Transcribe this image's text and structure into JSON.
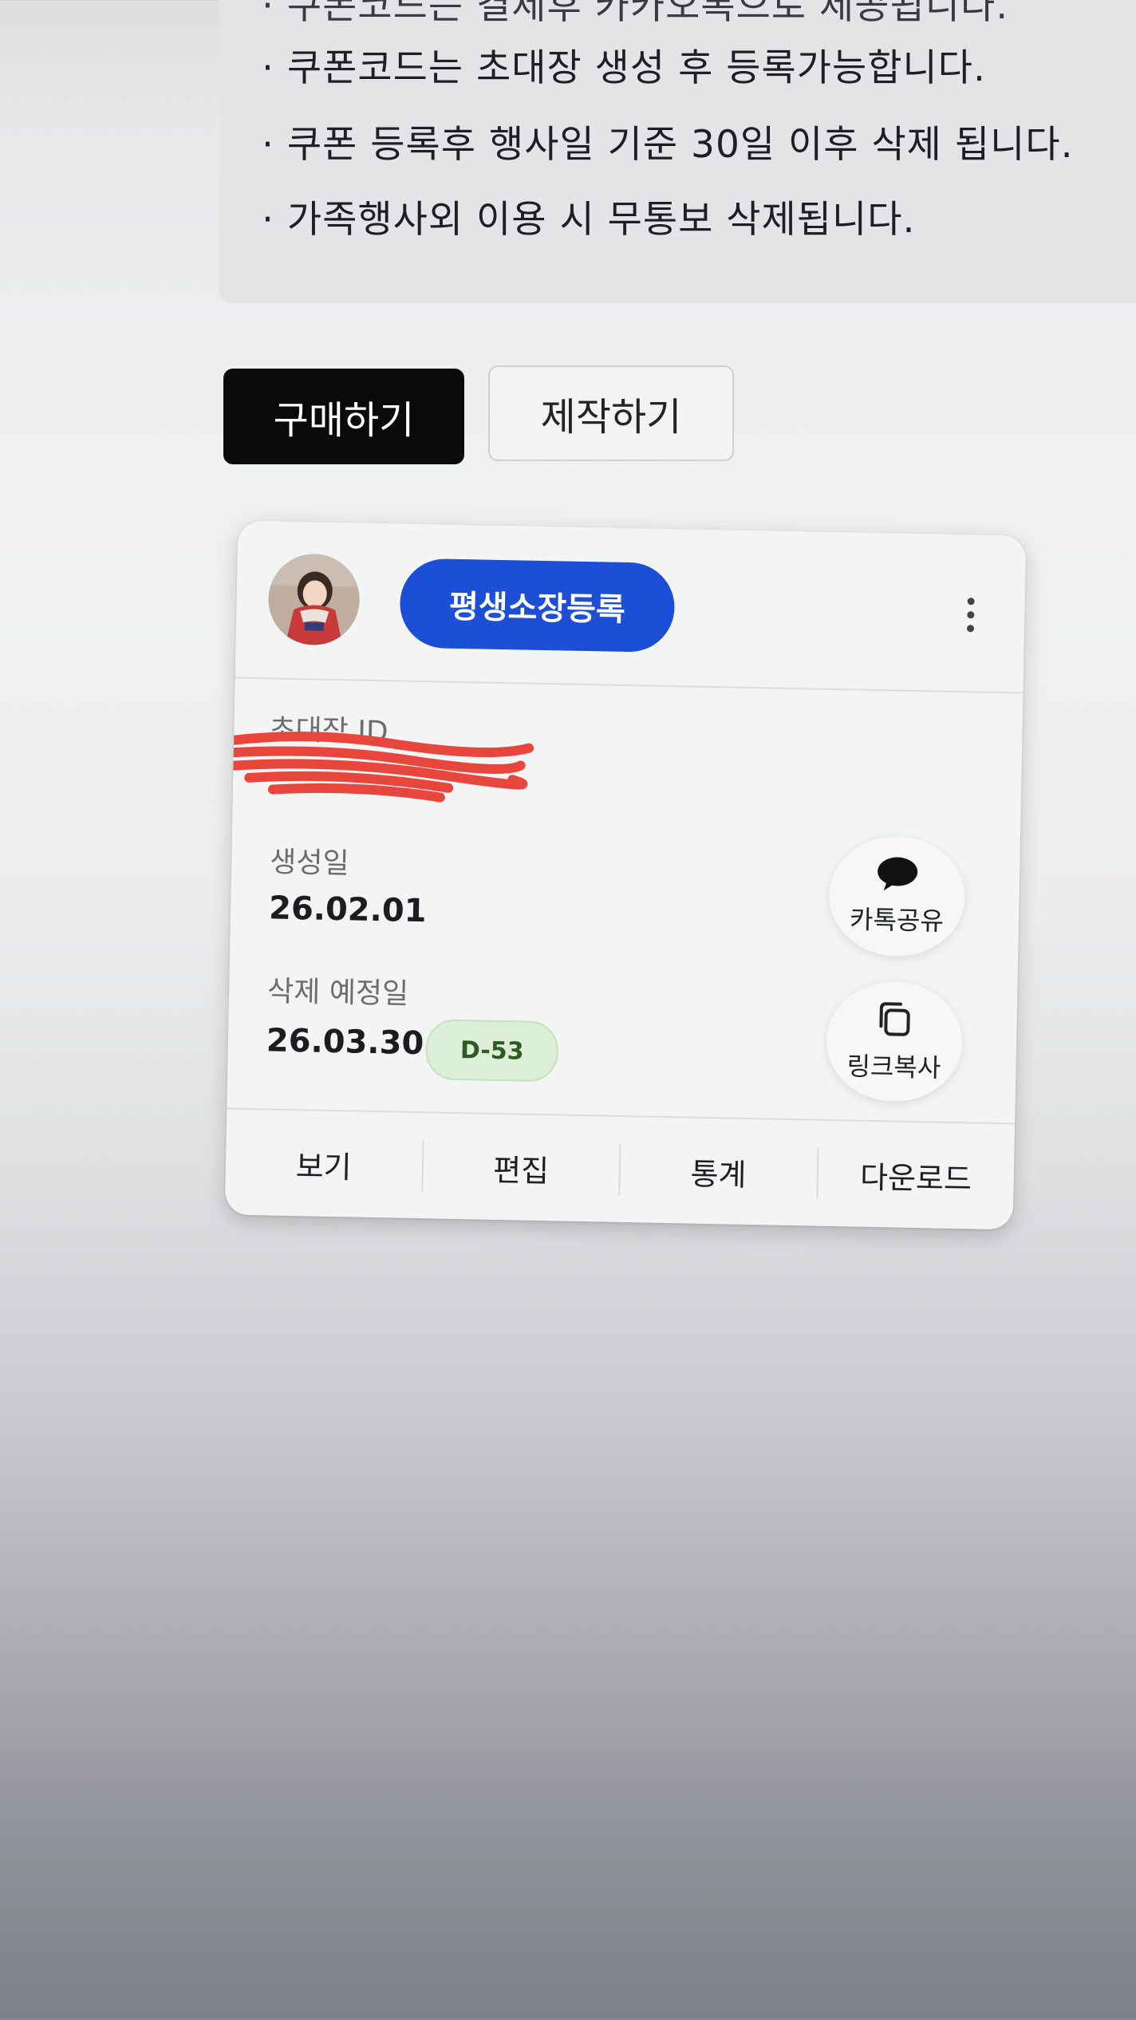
{
  "notice": {
    "lines": [
      "· 쿠폰코드는 결제후 카카오톡으로 제공됩니다.",
      "· 쿠폰코드는 초대장 생성 후 등록가능합니다.",
      "· 쿠폰 등록후 행사일 기준 30일 이후 삭제 됩니다.",
      "· 가족행사외 이용 시 무통보 삭제됩니다."
    ]
  },
  "actions": {
    "buy_label": "구매하기",
    "make_label": "제작하기"
  },
  "card": {
    "register_label": "평생소장등록",
    "invite_id_label": "초대장 ID",
    "created_label": "생성일",
    "created_value": "26.02.01",
    "expire_label": "삭제 예정일",
    "expire_value": "26.03.30",
    "dday_badge": "D-53",
    "kakao_share_label": "카톡공유",
    "copy_link_label": "링크복사",
    "bottom_actions": [
      "보기",
      "편집",
      "통계",
      "다운로드"
    ]
  },
  "colors": {
    "primary_blue": "#1d4fd6",
    "buy_button": "#0a0a0b",
    "badge_green_bg": "#dcefd6",
    "redaction_red": "#e8463c"
  },
  "icons": {
    "more": "more-vertical-icon",
    "kakao": "chat-bubble-icon",
    "copy": "copy-icon"
  }
}
